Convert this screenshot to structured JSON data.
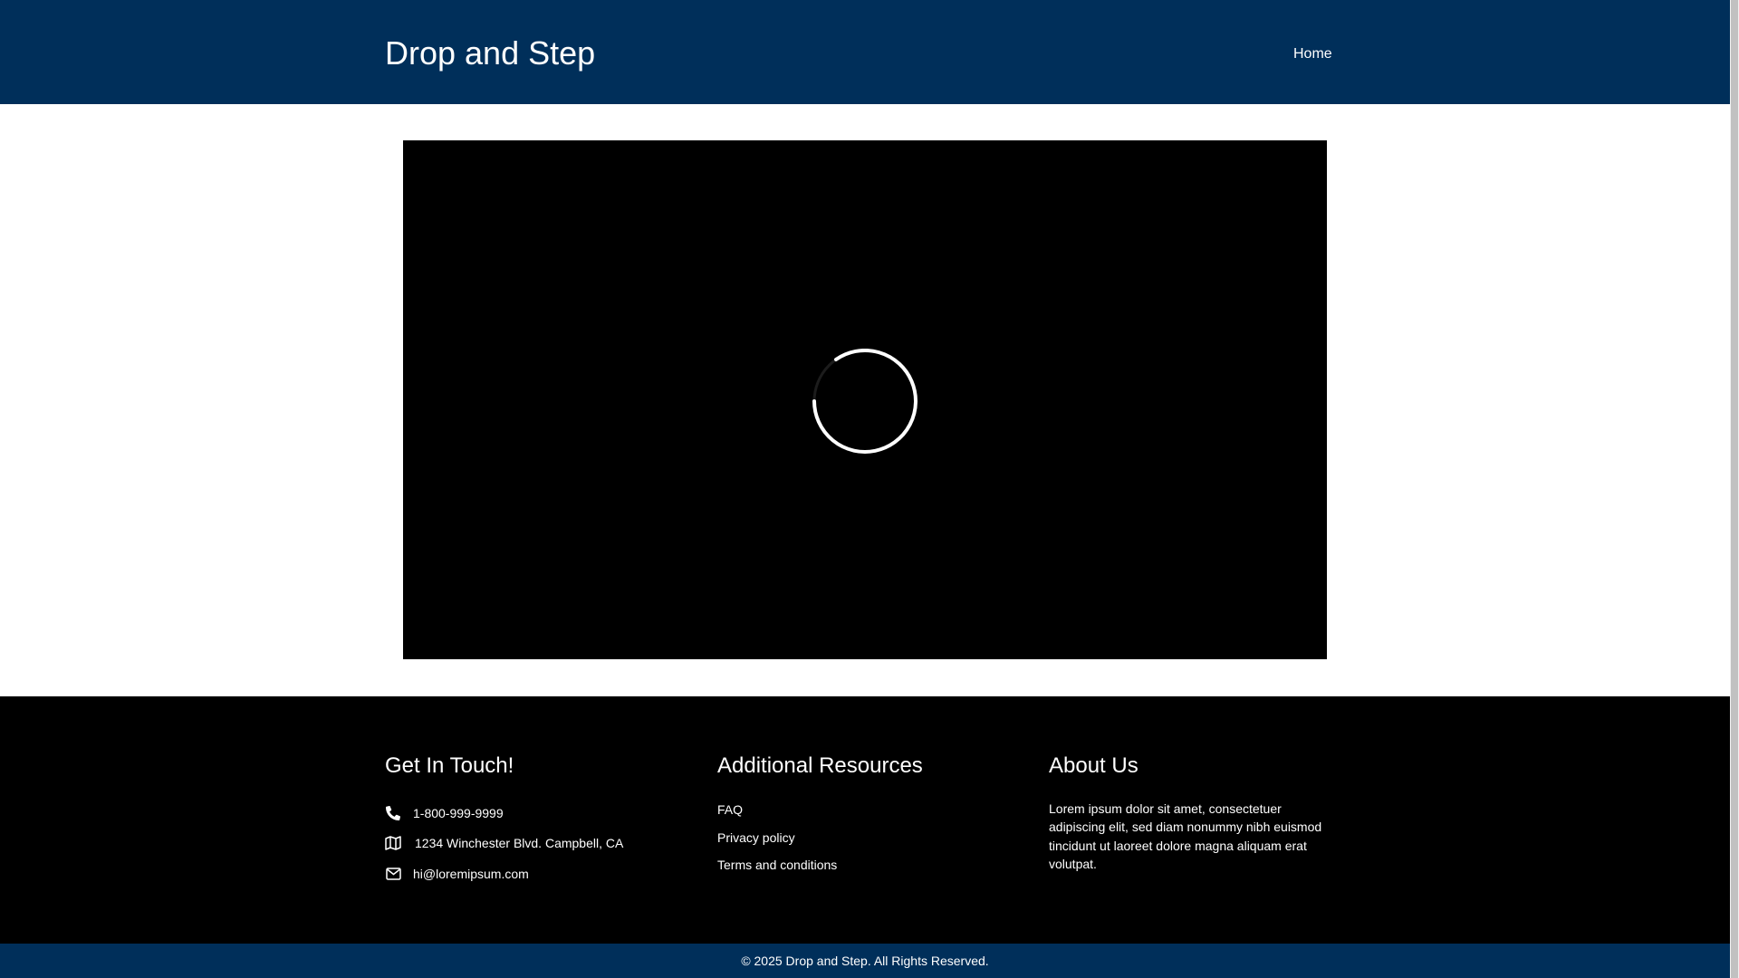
{
  "header": {
    "site_title": "Drop and Step",
    "nav": [
      {
        "label": "Home"
      }
    ]
  },
  "video": {
    "state": "loading",
    "spinner_icon": "loading-spinner-icon"
  },
  "footer": {
    "contact": {
      "heading": "Get In Touch!",
      "items": [
        {
          "icon": "phone-icon",
          "text": "1-800-999-9999"
        },
        {
          "icon": "map-icon",
          "text": "1234 Winchester Blvd. Campbell, CA"
        },
        {
          "icon": "envelope-icon",
          "text": "hi@loremipsum.com"
        }
      ]
    },
    "resources": {
      "heading": "Additional Resources",
      "links": [
        {
          "label": "FAQ"
        },
        {
          "label": "Privacy policy"
        },
        {
          "label": "Terms and conditions"
        }
      ]
    },
    "about": {
      "heading": "About Us",
      "text": "Lorem ipsum dolor sit amet, consectetuer adipiscing elit, sed diam nonummy nibh euismod tincidunt ut laoreet dolore magna aliquam erat volutpat."
    }
  },
  "bottom_bar": {
    "copyright": "© 2025 Drop and Step. All Rights Reserved."
  },
  "colors": {
    "header_bg": "#002f5a",
    "footer_bg": "#000000",
    "video_bg": "#000000",
    "text_on_dark": "#ffffff"
  }
}
